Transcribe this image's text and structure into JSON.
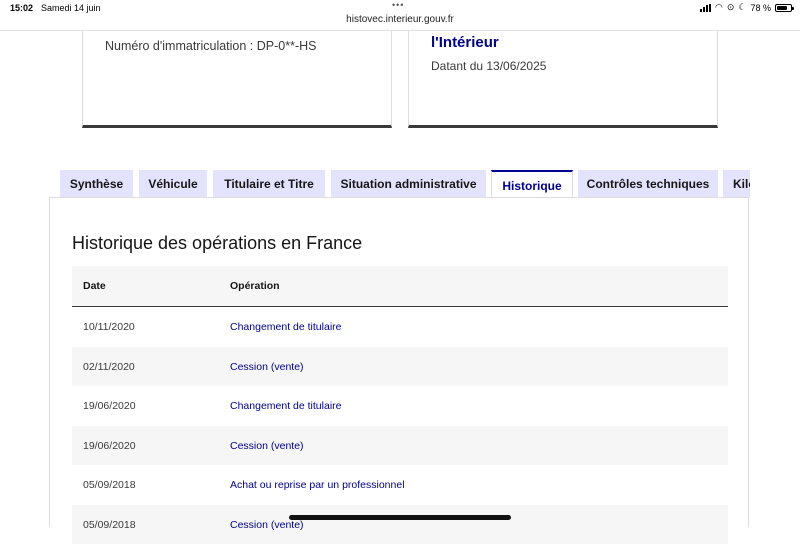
{
  "status_bar": {
    "time": "15:02",
    "date": "Samedi 14 juin",
    "battery": "78 %",
    "battery_level": 0.78
  },
  "browser": {
    "url": "histovec.interieur.gouv.fr"
  },
  "card_left": {
    "plate_text": "Numéro d'immatriculation : DP-0**-HS"
  },
  "card_right": {
    "title": "l'Intérieur",
    "date_text": "Datant du 13/06/2025"
  },
  "tabs": [
    {
      "label": "Synthèse"
    },
    {
      "label": "Véhicule"
    },
    {
      "label": "Titulaire et Titre"
    },
    {
      "label": "Situation administrative"
    },
    {
      "label": "Historique",
      "active": true
    },
    {
      "label": "Contrôles techniques"
    },
    {
      "label": "Kilo"
    }
  ],
  "section": {
    "title": "Historique des opérations en France"
  },
  "table": {
    "headers": {
      "date": "Date",
      "operation": "Opération"
    },
    "rows": [
      {
        "date": "10/11/2020",
        "operation": "Changement de titulaire"
      },
      {
        "date": "02/11/2020",
        "operation": "Cession (vente)"
      },
      {
        "date": "19/06/2020",
        "operation": "Changement de titulaire"
      },
      {
        "date": "19/06/2020",
        "operation": "Cession (vente)"
      },
      {
        "date": "05/09/2018",
        "operation": "Achat ou reprise par un professionnel"
      },
      {
        "date": "05/09/2018",
        "operation": "Cession (vente)"
      }
    ]
  },
  "colors": {
    "accent": "#000091",
    "tab_bg": "#e3e3fd",
    "row_alt": "#f6f6f6"
  }
}
